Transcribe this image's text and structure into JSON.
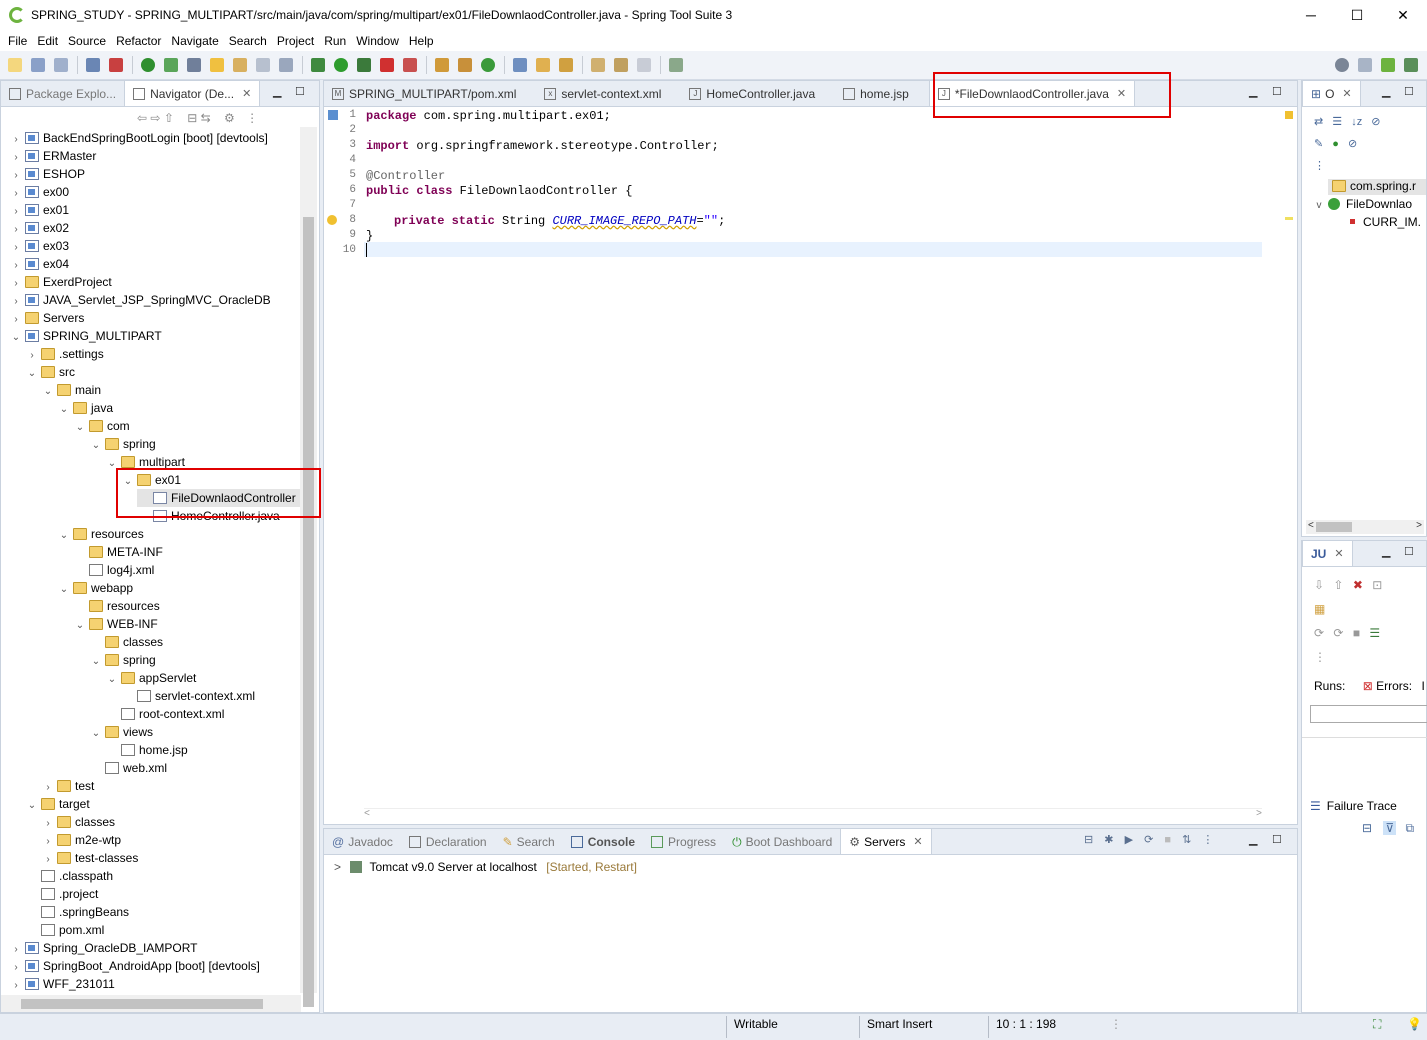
{
  "window": {
    "title": "SPRING_STUDY - SPRING_MULTIPART/src/main/java/com/spring/multipart/ex01/FileDownlaodController.java - Spring Tool Suite 3",
    "minimize": "─",
    "maximize": "☐",
    "close": "✕"
  },
  "menu": [
    "File",
    "Edit",
    "Source",
    "Refactor",
    "Navigate",
    "Search",
    "Project",
    "Run",
    "Window",
    "Help"
  ],
  "left_panel": {
    "tabs": [
      "Package Explo...",
      "Navigator (De..."
    ],
    "tree": [
      {
        "label": "BackEndSpringBootLogin [boot] [devtools]",
        "depth": 0,
        "tw": ">",
        "icon": "proj"
      },
      {
        "label": "ERMaster",
        "depth": 0,
        "tw": ">",
        "icon": "proj"
      },
      {
        "label": "ESHOP",
        "depth": 0,
        "tw": ">",
        "icon": "proj"
      },
      {
        "label": "ex00",
        "depth": 0,
        "tw": ">",
        "icon": "proj"
      },
      {
        "label": "ex01",
        "depth": 0,
        "tw": ">",
        "icon": "proj"
      },
      {
        "label": "ex02",
        "depth": 0,
        "tw": ">",
        "icon": "proj"
      },
      {
        "label": "ex03",
        "depth": 0,
        "tw": ">",
        "icon": "proj"
      },
      {
        "label": "ex04",
        "depth": 0,
        "tw": ">",
        "icon": "proj"
      },
      {
        "label": "ExerdProject",
        "depth": 0,
        "tw": ">",
        "icon": "folder"
      },
      {
        "label": "JAVA_Servlet_JSP_SpringMVC_OracleDB",
        "depth": 0,
        "tw": ">",
        "icon": "proj"
      },
      {
        "label": "Servers",
        "depth": 0,
        "tw": ">",
        "icon": "folder"
      },
      {
        "label": "SPRING_MULTIPART",
        "depth": 0,
        "tw": "v",
        "icon": "proj"
      },
      {
        "label": ".settings",
        "depth": 1,
        "tw": ">",
        "icon": "folder"
      },
      {
        "label": "src",
        "depth": 1,
        "tw": "v",
        "icon": "folder"
      },
      {
        "label": "main",
        "depth": 2,
        "tw": "v",
        "icon": "folder"
      },
      {
        "label": "java",
        "depth": 3,
        "tw": "v",
        "icon": "folder"
      },
      {
        "label": "com",
        "depth": 4,
        "tw": "v",
        "icon": "folder"
      },
      {
        "label": "spring",
        "depth": 5,
        "tw": "v",
        "icon": "folder"
      },
      {
        "label": "multipart",
        "depth": 6,
        "tw": "v",
        "icon": "folder"
      },
      {
        "label": "ex01",
        "depth": 7,
        "tw": "v",
        "icon": "folder"
      },
      {
        "label": "FileDownlaodController",
        "depth": 8,
        "tw": "",
        "icon": "filej",
        "selected": true
      },
      {
        "label": "HomeController.java",
        "depth": 8,
        "tw": "",
        "icon": "filej"
      },
      {
        "label": "resources",
        "depth": 3,
        "tw": "v",
        "icon": "folder"
      },
      {
        "label": "META-INF",
        "depth": 4,
        "tw": "",
        "icon": "folder"
      },
      {
        "label": "log4j.xml",
        "depth": 4,
        "tw": "",
        "icon": "filex"
      },
      {
        "label": "webapp",
        "depth": 3,
        "tw": "v",
        "icon": "folder"
      },
      {
        "label": "resources",
        "depth": 4,
        "tw": "",
        "icon": "folder"
      },
      {
        "label": "WEB-INF",
        "depth": 4,
        "tw": "v",
        "icon": "folder"
      },
      {
        "label": "classes",
        "depth": 5,
        "tw": "",
        "icon": "folder"
      },
      {
        "label": "spring",
        "depth": 5,
        "tw": "v",
        "icon": "folder"
      },
      {
        "label": "appServlet",
        "depth": 6,
        "tw": "v",
        "icon": "folder"
      },
      {
        "label": "servlet-context.xml",
        "depth": 7,
        "tw": "",
        "icon": "filex"
      },
      {
        "label": "root-context.xml",
        "depth": 6,
        "tw": "",
        "icon": "filex"
      },
      {
        "label": "views",
        "depth": 5,
        "tw": "v",
        "icon": "folder"
      },
      {
        "label": "home.jsp",
        "depth": 6,
        "tw": "",
        "icon": "filex"
      },
      {
        "label": "web.xml",
        "depth": 5,
        "tw": "",
        "icon": "filex"
      },
      {
        "label": "test",
        "depth": 2,
        "tw": ">",
        "icon": "folder"
      },
      {
        "label": "target",
        "depth": 1,
        "tw": "v",
        "icon": "folder"
      },
      {
        "label": "classes",
        "depth": 2,
        "tw": ">",
        "icon": "folder"
      },
      {
        "label": "m2e-wtp",
        "depth": 2,
        "tw": ">",
        "icon": "folder"
      },
      {
        "label": "test-classes",
        "depth": 2,
        "tw": ">",
        "icon": "folder"
      },
      {
        "label": ".classpath",
        "depth": 1,
        "tw": "",
        "icon": "filex"
      },
      {
        "label": ".project",
        "depth": 1,
        "tw": "",
        "icon": "filex"
      },
      {
        "label": ".springBeans",
        "depth": 1,
        "tw": "",
        "icon": "filex"
      },
      {
        "label": "pom.xml",
        "depth": 1,
        "tw": "",
        "icon": "filex"
      },
      {
        "label": "Spring_OracleDB_IAMPORT",
        "depth": 0,
        "tw": ">",
        "icon": "proj"
      },
      {
        "label": "SpringBoot_AndroidApp [boot] [devtools]",
        "depth": 0,
        "tw": ">",
        "icon": "proj"
      },
      {
        "label": "WFF_231011",
        "depth": 0,
        "tw": ">",
        "icon": "proj"
      }
    ]
  },
  "editor": {
    "tabs": [
      {
        "label": "SPRING_MULTIPART/pom.xml",
        "icon": "M"
      },
      {
        "label": "servlet-context.xml",
        "icon": "x"
      },
      {
        "label": "HomeController.java",
        "icon": "J"
      },
      {
        "label": "home.jsp",
        "icon": ""
      },
      {
        "label": "*FileDownlaodController.java",
        "icon": "J",
        "active": true
      }
    ],
    "line_numbers": [
      "1",
      "2",
      "3",
      "4",
      "5",
      "6",
      "7",
      "8",
      "9",
      "10"
    ],
    "code": {
      "l1_kw": "package",
      "l1_rest": " com.spring.multipart.ex01;",
      "l3_kw": "import",
      "l3_rest": " org.springframework.stereotype.Controller;",
      "l5": "@Controller",
      "l6_kw": "public class",
      "l6_rest": " FileDownlaodController {",
      "l8_kw": "private static",
      "l8_type": " String ",
      "l8_field": "CURR_IMAGE_REPO_PATH",
      "l8_eq": "=",
      "l8_str": "\"\"",
      "l8_end": ";",
      "l9": "}"
    }
  },
  "bottom_panel": {
    "tabs": [
      "Javadoc",
      "Declaration",
      "Search",
      "Console",
      "Progress",
      "Boot Dashboard",
      "Servers"
    ],
    "active_tab": "Servers",
    "server_name": "Tomcat v9.0 Server at localhost",
    "server_state": "[Started, Restart]"
  },
  "outline_panel": {
    "tab": "O",
    "items": [
      "com.spring.r",
      "FileDownlao",
      "CURR_IM."
    ]
  },
  "junit_panel": {
    "tab": "JU",
    "runs_label": "Runs:",
    "errors_label": "Errors:",
    "errors_value": "I",
    "failure_trace": "Failure Trace"
  },
  "status": {
    "writable": "Writable",
    "insert_mode": "Smart Insert",
    "position": "10 : 1 : 198"
  },
  "colors": {
    "accent": "#6db33f",
    "highlight": "#e00000",
    "keyword": "#7f0055",
    "string": "#2a00ff",
    "field": "#0000c0"
  }
}
